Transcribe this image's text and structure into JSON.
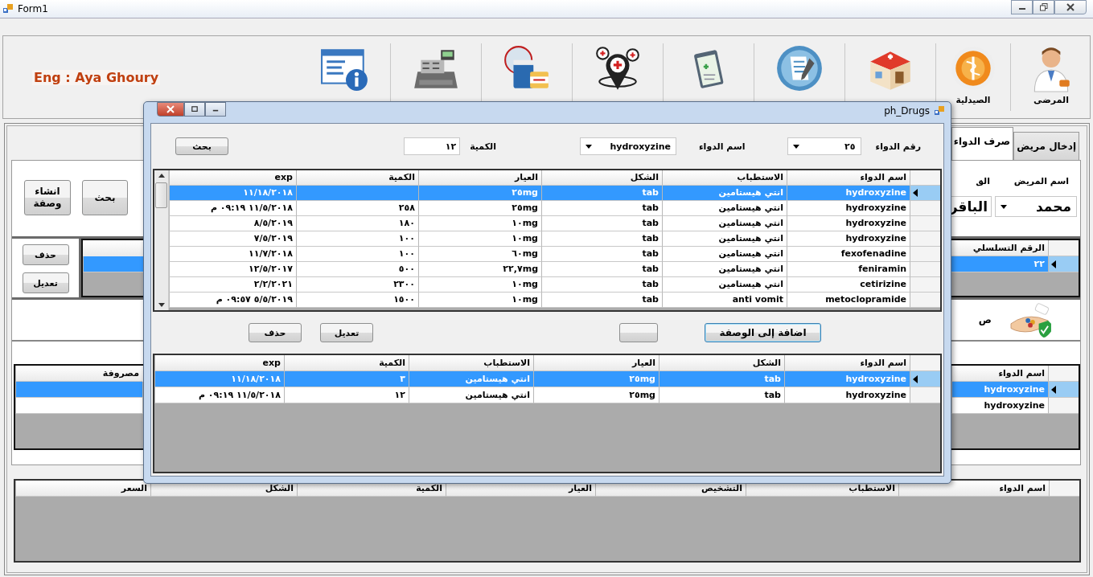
{
  "window": {
    "title": "Form1"
  },
  "author": "Eng : Aya Ghoury",
  "toolbar": {
    "labels": [
      "المرضى",
      "الصيدلية"
    ]
  },
  "tabs": [
    {
      "label": "إدخال مريض",
      "selected": false
    },
    {
      "label": "صرف الدواء",
      "selected": true
    }
  ],
  "prescription_form": {
    "patient_label": "اسم المريض",
    "label_2": "الق",
    "patient_first": "محمد",
    "patient_second": "الباقر",
    "search_button": "بحث",
    "create_button": "انشاء وصفة"
  },
  "serial_grid": {
    "columns": [
      "الرقم التسلسلي"
    ],
    "rows": [
      {
        "cells": [
          "٢٢"
        ],
        "selected": true
      }
    ]
  },
  "serial_buttons": [
    "حذف",
    "تعديل"
  ],
  "dispense_label": "ص",
  "dispensed_grid": {
    "columns": [
      "اسم الدواء",
      "مصروفة"
    ],
    "rows": [
      {
        "cells": [
          "hydroxyzine"
        ],
        "selected": true
      },
      {
        "cells": [
          "hydroxyzine"
        ],
        "selected": false
      }
    ]
  },
  "prescription_grid": {
    "columns": [
      "اسم الدواء",
      "الاستطباب",
      "التشخيص",
      "العيار",
      "الكمية",
      "الشكل",
      "السعر"
    ]
  },
  "dialog": {
    "title": "ph_Drugs",
    "search": {
      "number_label": "رقم الدواء",
      "number": "٢٥",
      "name_label": "اسم الدواء",
      "name": "hydroxyzine",
      "quantity_label": "الكمية",
      "quantity": "١٢",
      "search_button": "بحث"
    },
    "drug_grid": {
      "columns": [
        "اسم الدواء",
        "الاستطباب",
        "الشكل",
        "العيار",
        "الكمية",
        "exp"
      ],
      "rows": [
        {
          "cells": [
            "hydroxyzine",
            "انتي هيستامين",
            "tab",
            "٢٥mg",
            null,
            "١١/١٨/٢٠١٨"
          ],
          "selected": true
        },
        {
          "cells": [
            "hydroxyzine",
            "انتي هيستامين",
            "tab",
            "٢٥mg",
            "٢٥٨",
            "١١/٥/٢٠١٨ ٠٩:١٩ م"
          ],
          "selected": false
        },
        {
          "cells": [
            "hydroxyzine",
            "انتي هيستامين",
            "tab",
            "١٠mg",
            "١٨٠",
            "٨/٥/٢٠١٩"
          ],
          "selected": false
        },
        {
          "cells": [
            "hydroxyzine",
            "انتي هيستامين",
            "tab",
            "١٠mg",
            "١٠٠",
            "٧/٥/٢٠١٩"
          ],
          "selected": false
        },
        {
          "cells": [
            "fexofenadine",
            "انتي هيستامين",
            "tab",
            "٦٠mg",
            "١٠٠",
            "١١/٧/٢٠١٨"
          ],
          "selected": false
        },
        {
          "cells": [
            "feniramin",
            "انتي هيستامين",
            "tab",
            "٢٢,٧mg",
            "٥٠٠",
            "١٢/٥/٢٠١٧"
          ],
          "selected": false
        },
        {
          "cells": [
            "cetirizine",
            "انتي هيستامين",
            "tab",
            "١٠mg",
            "٢٣٠٠",
            "٢/٢/٢٠٢١"
          ],
          "selected": false
        },
        {
          "cells": [
            "metoclopramide",
            "anti vomit",
            "tab",
            "١٠mg",
            "١٥٠٠",
            "٥/٥/٢٠١٩ ٠٩:٥٧ م"
          ],
          "selected": false
        }
      ]
    },
    "buttons": [
      {
        "kind": "labeled",
        "label": "اضافة إلى الوصفة"
      },
      {
        "kind": "blank"
      },
      {
        "kind": "labeled",
        "label": "تعديل"
      },
      {
        "kind": "labeled",
        "label": "حذف"
      }
    ],
    "prescription_grid": {
      "columns": [
        "اسم الدواء",
        "الشكل",
        "العيار",
        "الاستطباب",
        "الكمية",
        "exp"
      ],
      "rows": [
        {
          "cells": [
            "hydroxyzine",
            "tab",
            "٢٥mg",
            "انتي هيستامين",
            "٣",
            "١١/١٨/٢٠١٨"
          ],
          "selected": true
        },
        {
          "cells": [
            "hydroxyzine",
            "tab",
            "٢٥mg",
            "انتي هيستامين",
            "١٢",
            "١١/٥/٢٠١٨ ٠٩:١٩ م"
          ],
          "selected": false
        }
      ]
    }
  }
}
